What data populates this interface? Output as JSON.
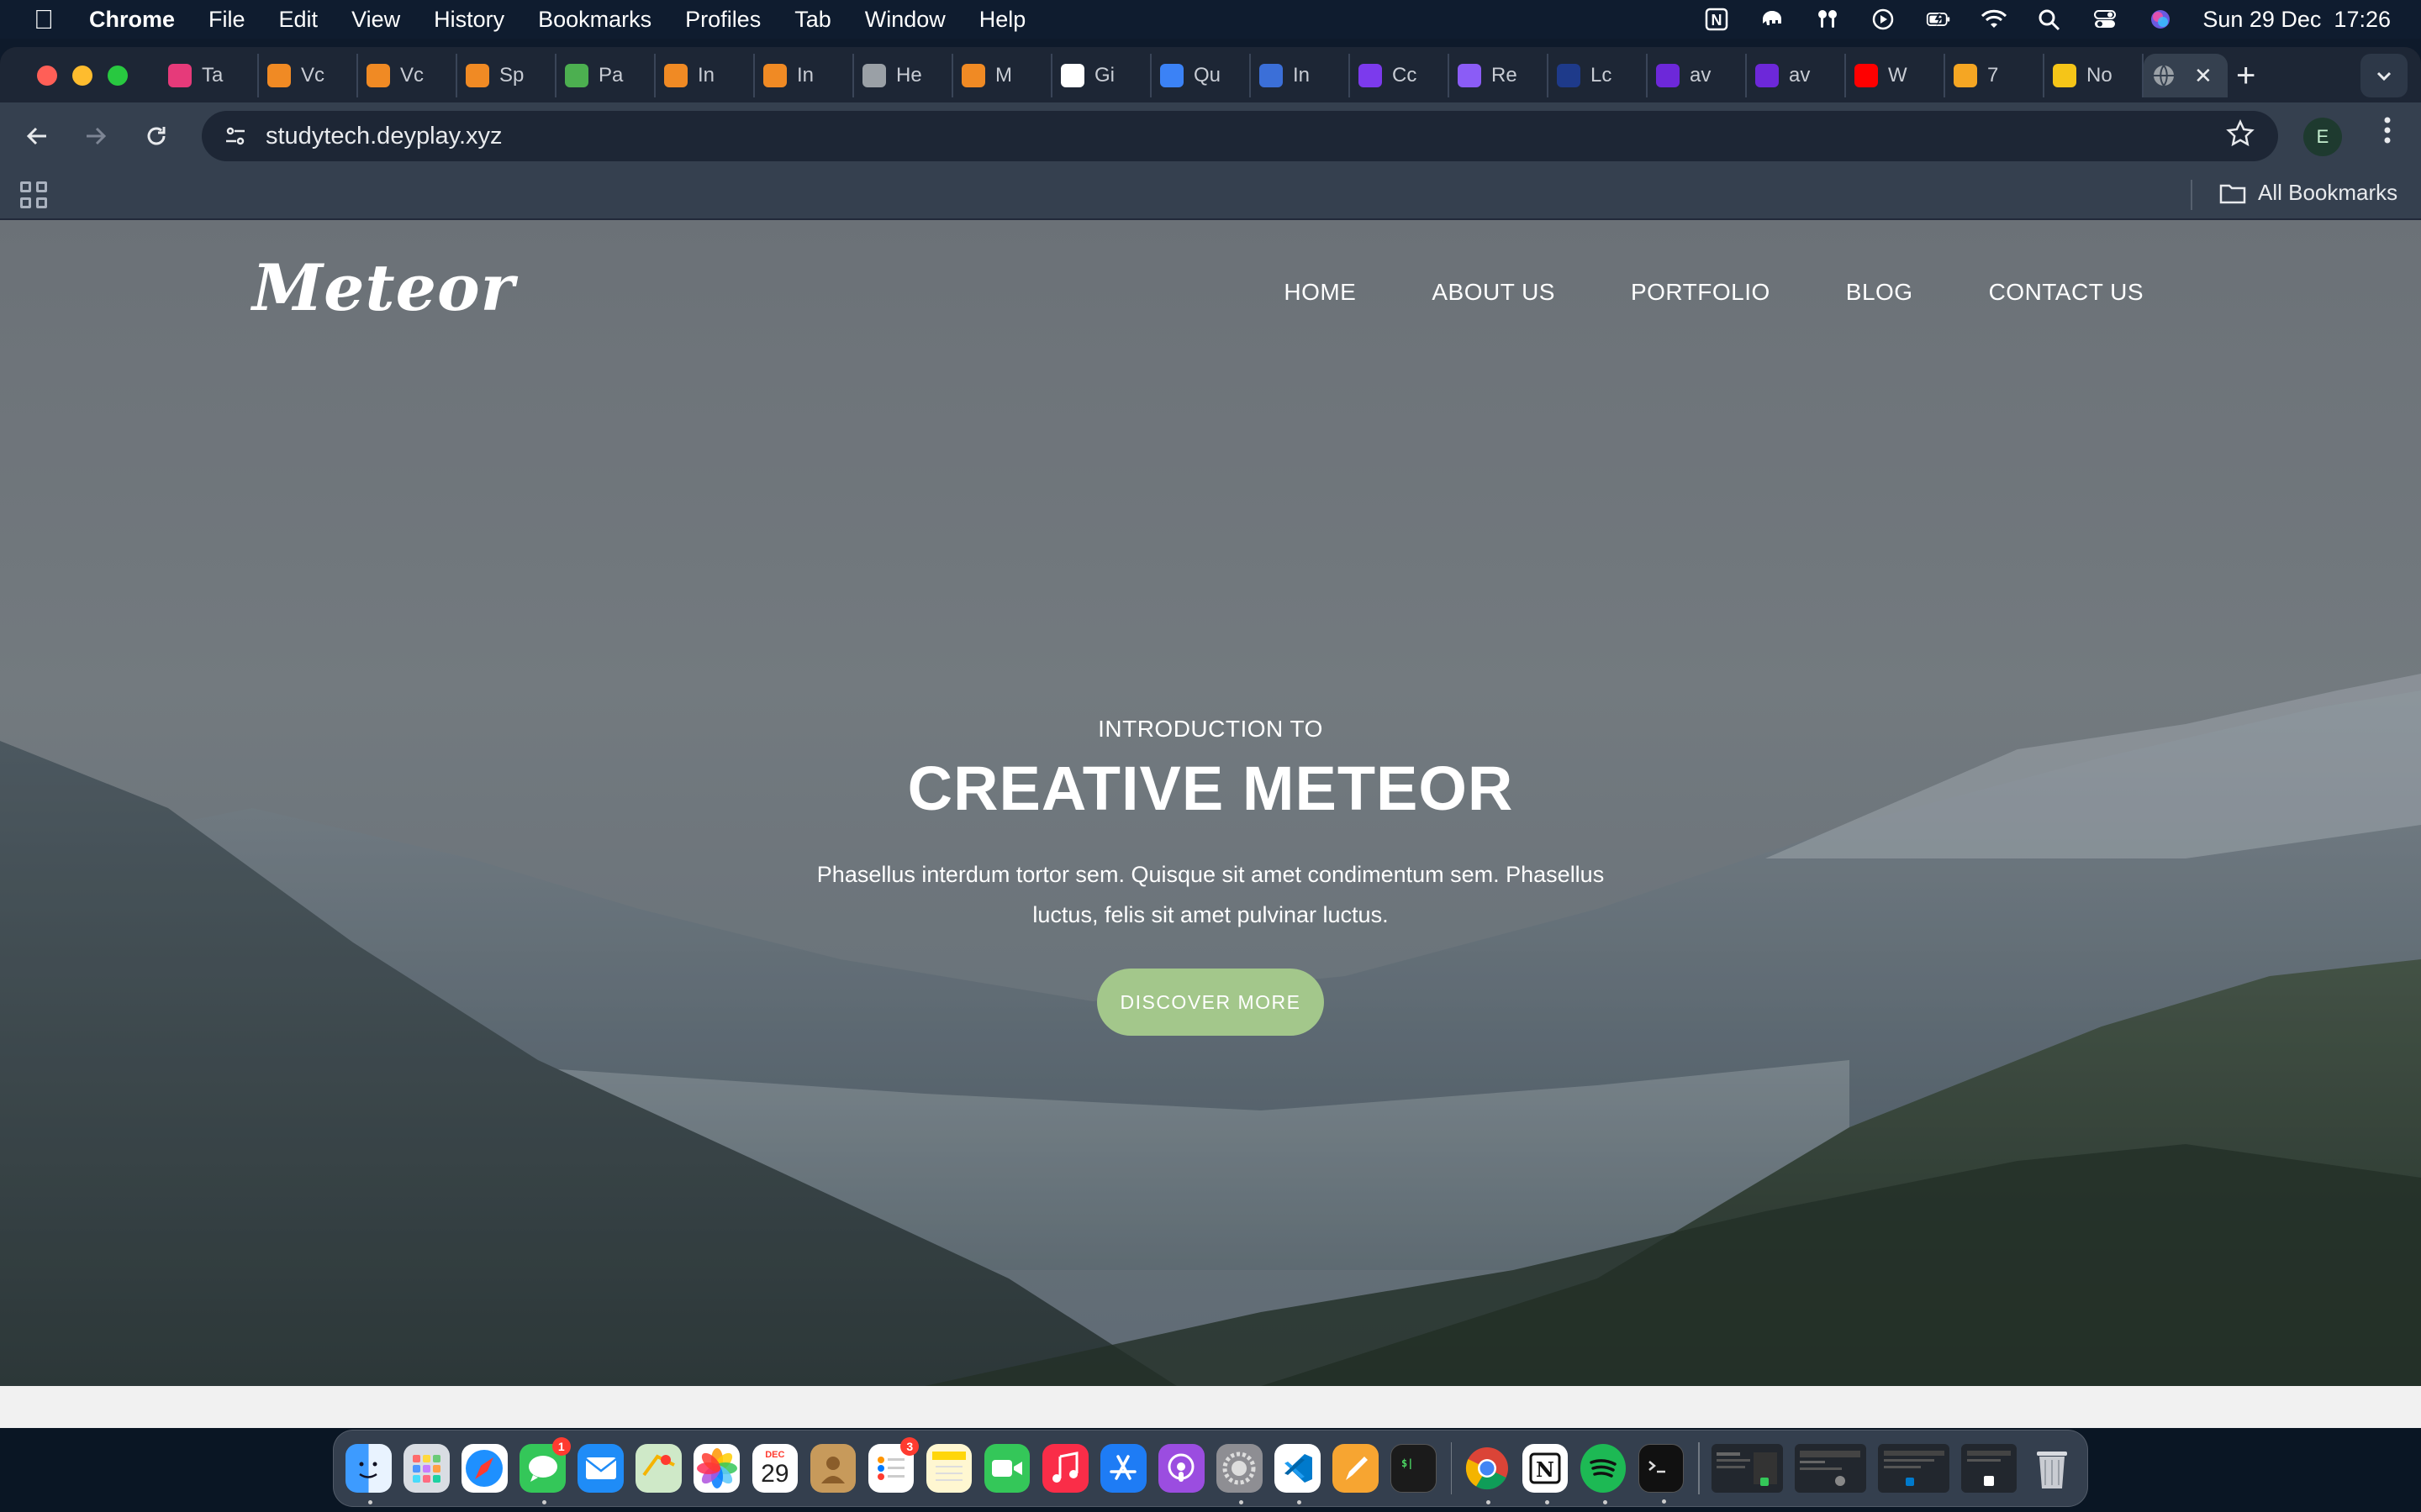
{
  "menubar": {
    "app_name": "Chrome",
    "items": [
      "File",
      "Edit",
      "View",
      "History",
      "Bookmarks",
      "Profiles",
      "Tab",
      "Window",
      "Help"
    ],
    "datetime": "Sun 29 Dec  17:26"
  },
  "tabs": [
    {
      "title": "Ta",
      "color": "#e63a7a"
    },
    {
      "title": "Vc",
      "color": "#f08a24"
    },
    {
      "title": "Vc",
      "color": "#f08a24"
    },
    {
      "title": "Sp",
      "color": "#f08a24"
    },
    {
      "title": "Pa",
      "color": "#4caf50"
    },
    {
      "title": "In",
      "color": "#f08a24"
    },
    {
      "title": "In",
      "color": "#f08a24"
    },
    {
      "title": "He",
      "color": "#9aa0a6"
    },
    {
      "title": "M",
      "color": "#f08a24"
    },
    {
      "title": "Gi",
      "color": "#ffffff"
    },
    {
      "title": "Qu",
      "color": "#3b82f6"
    },
    {
      "title": "In",
      "color": "#3b6fd8"
    },
    {
      "title": "Cc",
      "color": "#7c3aed"
    },
    {
      "title": "Re",
      "color": "#8b5cf6"
    },
    {
      "title": "Lc",
      "color": "#1e3a8a"
    },
    {
      "title": "av",
      "color": "#6d28d9"
    },
    {
      "title": "av",
      "color": "#6d28d9"
    },
    {
      "title": "W",
      "color": "#ff0000"
    },
    {
      "title": "7",
      "color": "#f5a623"
    },
    {
      "title": "No",
      "color": "#f5c518"
    }
  ],
  "address_bar": {
    "url": "studytech.deyplay.xyz"
  },
  "profile_initial": "E",
  "bookmarks_bar": {
    "all_bookmarks_label": "All Bookmarks"
  },
  "site": {
    "logo": "Meteor",
    "nav": [
      "HOME",
      "ABOUT US",
      "PORTFOLIO",
      "BLOG",
      "CONTACT US"
    ],
    "hero": {
      "kicker": "INTRODUCTION TO",
      "title": "CREATIVE METEOR",
      "text": "Phasellus interdum tortor sem. Quisque sit amet condimentum sem. Phasellus luctus, felis sit amet pulvinar luctus.",
      "button": "DISCOVER MORE"
    }
  },
  "dock": {
    "calendar_month": "DEC",
    "calendar_day": "29",
    "messages_badge": "1",
    "reminders_badge": "3"
  }
}
